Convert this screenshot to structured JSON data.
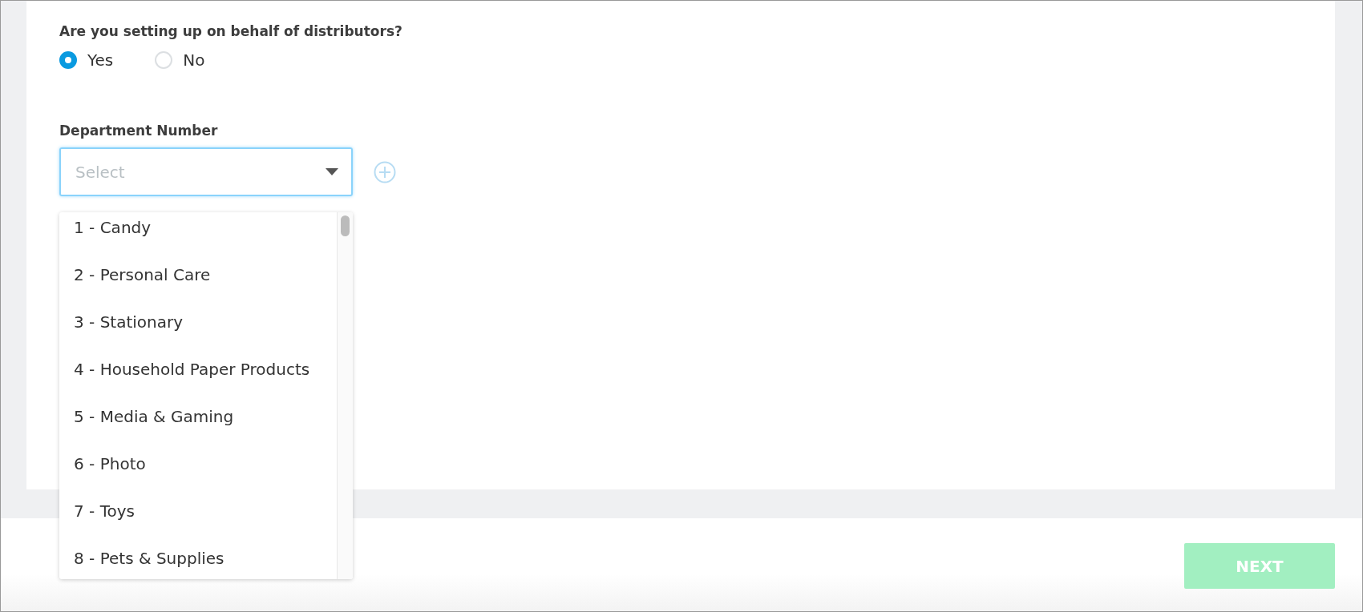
{
  "question": {
    "label": "Are you setting up on behalf of distributors?",
    "options": [
      {
        "label": "Yes",
        "selected": true
      },
      {
        "label": "No",
        "selected": false
      }
    ]
  },
  "department": {
    "label": "Department Number",
    "placeholder": "Select",
    "expanded": true,
    "options": [
      {
        "label": "1 - Candy"
      },
      {
        "label": "2 - Personal Care"
      },
      {
        "label": "3 - Stationary"
      },
      {
        "label": "4 - Household Paper Products"
      },
      {
        "label": "5 - Media & Gaming"
      },
      {
        "label": "6 - Photo"
      },
      {
        "label": "7 - Toys"
      },
      {
        "label": "8 - Pets & Supplies"
      }
    ]
  },
  "next_button": {
    "label": "NEXT",
    "disabled": true
  }
}
